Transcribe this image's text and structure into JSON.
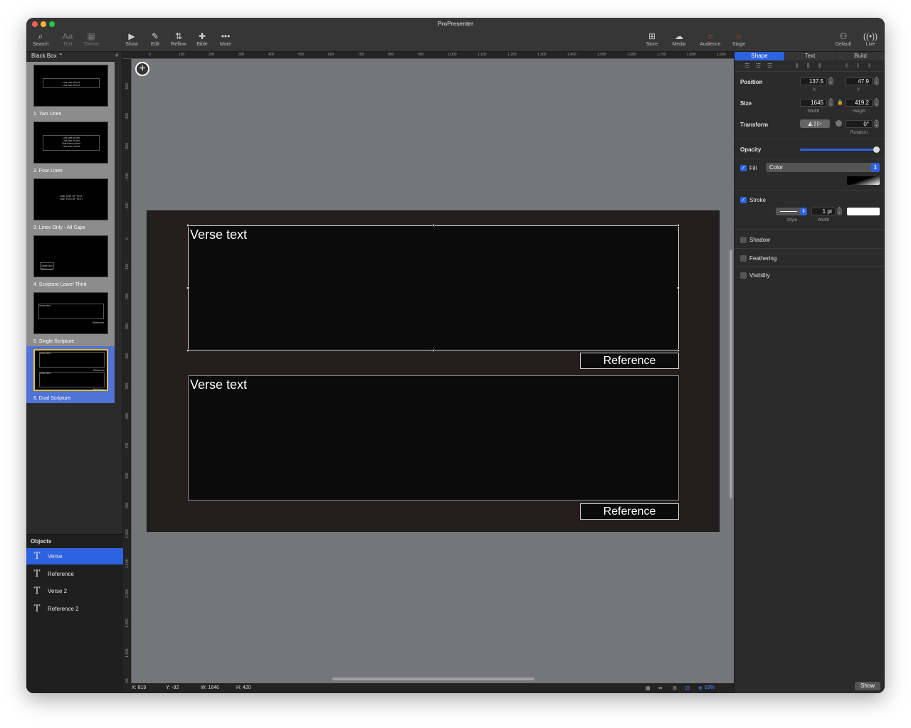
{
  "window": {
    "title": "ProPresenter"
  },
  "toolbar": {
    "left": [
      {
        "label": "Search",
        "icon": "search-icon",
        "glyph": "⌕",
        "dim": false
      },
      {
        "label": "Text",
        "icon": "text-icon",
        "glyph": "Aa",
        "dim": true
      },
      {
        "label": "Theme",
        "icon": "theme-icon",
        "glyph": "▦",
        "dim": true
      }
    ],
    "center": [
      {
        "label": "Show",
        "icon": "play-icon",
        "glyph": "▶"
      },
      {
        "label": "Edit",
        "icon": "pencil-icon",
        "glyph": "✎"
      },
      {
        "label": "Reflow",
        "icon": "reflow-icon",
        "glyph": "⇅"
      },
      {
        "label": "Bible",
        "icon": "bible-icon",
        "glyph": "✚"
      },
      {
        "label": "More",
        "icon": "more-icon",
        "glyph": "•••"
      }
    ],
    "right": [
      {
        "label": "Store",
        "icon": "cart-icon",
        "glyph": "⊞"
      },
      {
        "label": "Media",
        "icon": "media-icon",
        "glyph": "☁"
      },
      {
        "label": "Audience",
        "icon": "audience-icon",
        "glyph": "○"
      },
      {
        "label": "Stage",
        "icon": "stage-icon",
        "glyph": "○"
      }
    ],
    "far_right": [
      {
        "label": "Default",
        "icon": "default-icon",
        "glyph": "⚇"
      },
      {
        "label": "Live",
        "icon": "live-icon",
        "glyph": "((•))"
      }
    ],
    "accent_red": "#e64a3b"
  },
  "library": {
    "selector": "Black Box",
    "slides": [
      {
        "label": "1.  Two Lines",
        "lines": [
          "Line one of text",
          "Line two of text"
        ]
      },
      {
        "label": "2.  Four Lines",
        "lines": [
          "Line one of text",
          "Line two of text",
          "Line three of text",
          "Line four of text"
        ]
      },
      {
        "label": "3.  Lines Only - All Caps",
        "lines": [
          "LINE ONE OF TEXT",
          "LINE TWO OF TEXT"
        ]
      },
      {
        "label": "4.  Scripture Lower Third",
        "lines": [
          "Verse text",
          "Reference"
        ]
      },
      {
        "label": "5.  Single Scripture",
        "lines": [
          "Verse text",
          "Reference"
        ]
      },
      {
        "label": "6.  Dual Scripture",
        "lines": [
          "Verse text",
          "Reference",
          "Verse text",
          "Reference"
        ]
      }
    ]
  },
  "objects": {
    "header": "Objects",
    "items": [
      "Verse",
      "Reference",
      "Verse 2",
      "Reference 2"
    ]
  },
  "ruler": {
    "top": [
      "0",
      "100",
      "200",
      "300",
      "400",
      "500",
      "600",
      "700",
      "800",
      "900",
      "1,000",
      "1,100",
      "1,200",
      "1,300",
      "1,400",
      "1,500",
      "1,600",
      "1,700",
      "1,800",
      "1,900"
    ],
    "left": [
      "-500",
      "-400",
      "-300",
      "-200",
      "-100",
      "0",
      "100",
      "200",
      "300",
      "400",
      "500",
      "600",
      "700",
      "800",
      "900",
      "1,000",
      "1,100",
      "1,200",
      "1,300",
      "1,400",
      "1,500"
    ]
  },
  "slide": {
    "verse1": "Verse text",
    "reference1": "Reference",
    "verse2": "Verse text",
    "reference2": "Reference"
  },
  "status": {
    "x": "X: 819",
    "y": "Y: -92",
    "w": "W: 1646",
    "h": "H: 420",
    "zoom": "63%"
  },
  "inspector": {
    "tabs": [
      "Shape",
      "Text",
      "Build"
    ],
    "position": {
      "label": "Position",
      "x": "137.5",
      "y": "47.9",
      "x_sub": "X",
      "y_sub": "Y"
    },
    "size": {
      "label": "Size",
      "width": "1645",
      "height": "419.2",
      "w_sub": "Width",
      "h_sub": "Height"
    },
    "transform": {
      "label": "Transform",
      "rotation": "0°",
      "rot_sub": "Rotation"
    },
    "opacity": {
      "label": "Opacity",
      "value": 1.0
    },
    "fill": {
      "label": "Fill",
      "type": "Color",
      "checked": true
    },
    "stroke": {
      "label": "Stroke",
      "width": "1 pt",
      "style_sub": "Style",
      "width_sub": "Width",
      "checked": true
    },
    "shadow": "Shadow",
    "feathering": "Feathering",
    "visibility": "Visibility",
    "show_button": "Show",
    "accent": "#2d63e0"
  }
}
